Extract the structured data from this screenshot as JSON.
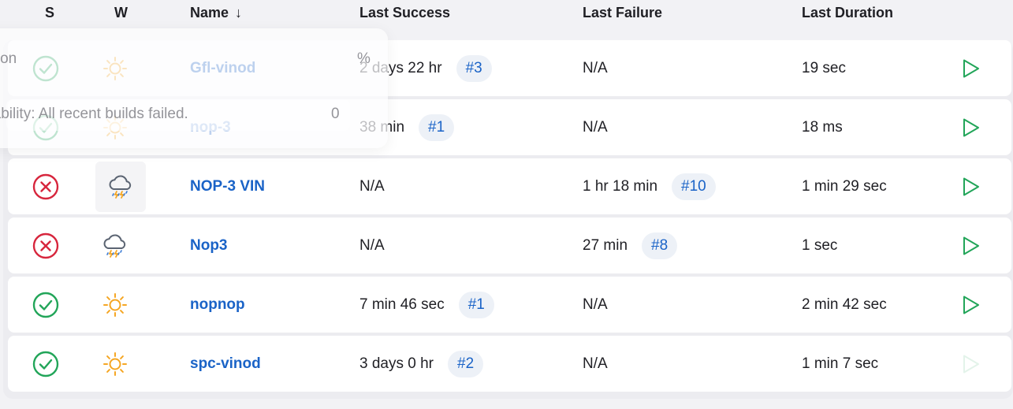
{
  "header": {
    "s": "S",
    "w": "W",
    "name": "Name",
    "name_sort": "↓",
    "last_success": "Last Success",
    "last_failure": "Last Failure",
    "last_duration": "Last Duration"
  },
  "rows": [
    {
      "status": "success",
      "weather": "sunny",
      "name": "Gfl-vinod",
      "last_success": "2 days 22 hr",
      "success_build": "#3",
      "last_failure": "N/A",
      "failure_build": "",
      "last_duration": "19 sec"
    },
    {
      "status": "success",
      "weather": "sunny",
      "name": "nop-3",
      "last_success": "38 min",
      "success_build": "#1",
      "last_failure": "N/A",
      "failure_build": "",
      "last_duration": "18 ms"
    },
    {
      "status": "failed",
      "weather": "stormy",
      "name": "NOP-3 VIN",
      "last_success": "N/A",
      "success_build": "",
      "last_failure": "1 hr 18 min",
      "failure_build": "#10",
      "last_duration": "1 min 29 sec"
    },
    {
      "status": "failed",
      "weather": "stormy",
      "name": "Nop3",
      "last_success": "N/A",
      "success_build": "",
      "last_failure": "27 min",
      "failure_build": "#8",
      "last_duration": "1 sec"
    },
    {
      "status": "success",
      "weather": "sunny",
      "name": "nopnop",
      "last_success": "7 min 46 sec",
      "success_build": "#1",
      "last_failure": "N/A",
      "failure_build": "",
      "last_duration": "2 min 42 sec"
    },
    {
      "status": "success",
      "weather": "sunny",
      "name": "spc-vinod",
      "last_success": "3 days 0 hr",
      "success_build": "#2",
      "last_failure": "N/A",
      "failure_build": "",
      "last_duration": "1 min 7 sec"
    }
  ],
  "tooltip": {
    "row1_text": "cription",
    "row1_value": "%",
    "row2_text": "d stability: All recent builds failed.",
    "row2_value": "0"
  },
  "colors": {
    "success": "#22a559",
    "failed": "#d7263d",
    "link": "#1a63c7",
    "run": "#22a559",
    "sun": "#f5a623"
  },
  "icons": {
    "success": "check-circle-icon",
    "failed": "x-circle-icon",
    "sunny": "sun-icon",
    "stormy": "storm-cloud-icon",
    "run": "play-icon"
  }
}
